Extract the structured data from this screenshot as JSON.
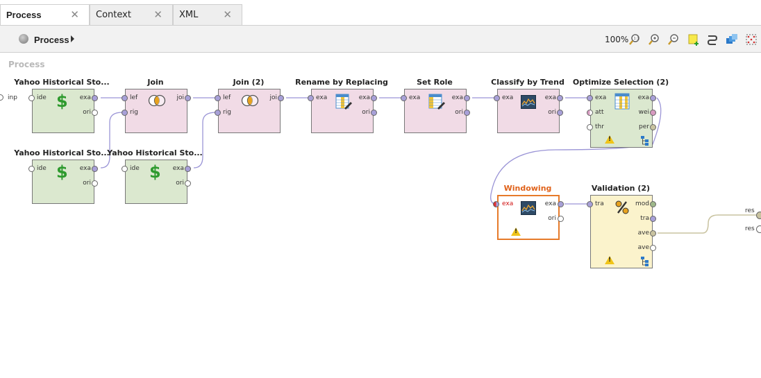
{
  "tabs": [
    {
      "label": "Process",
      "active": true
    },
    {
      "label": "Context",
      "active": false
    },
    {
      "label": "XML",
      "active": false
    }
  ],
  "toolbar": {
    "breadcrumb": "Process",
    "zoom": "100%",
    "icons": [
      "zoom-fit-icon",
      "zoom-in-icon",
      "zoom-out-icon",
      "add-note-icon",
      "auto-wire-icon",
      "arrange-icon",
      "show-grid-icon"
    ]
  },
  "canvas": {
    "label": "Process",
    "left_port": "inp",
    "right_ports": [
      "res",
      "res"
    ]
  },
  "operators": {
    "yahoo1": {
      "title": "Yahoo Historical Sto...",
      "in": [
        "ide"
      ],
      "out": [
        "exa",
        "ori"
      ]
    },
    "yahoo2": {
      "title": "Yahoo Historical Sto...",
      "in": [
        "ide"
      ],
      "out": [
        "exa",
        "ori"
      ]
    },
    "yahoo3": {
      "title": "Yahoo Historical Sto...",
      "in": [
        "ide"
      ],
      "out": [
        "exa",
        "ori"
      ]
    },
    "join1": {
      "title": "Join",
      "in": [
        "lef",
        "rig"
      ],
      "out": [
        "joi"
      ]
    },
    "join2": {
      "title": "Join (2)",
      "in": [
        "lef",
        "rig"
      ],
      "out": [
        "joi"
      ]
    },
    "rename": {
      "title": "Rename by Replacing",
      "in": [
        "exa"
      ],
      "out": [
        "exa",
        "ori"
      ]
    },
    "setrole": {
      "title": "Set Role",
      "in": [
        "exa"
      ],
      "out": [
        "exa",
        "ori"
      ]
    },
    "classify": {
      "title": "Classify by Trend",
      "in": [
        "exa"
      ],
      "out": [
        "exa",
        "ori"
      ]
    },
    "optimize": {
      "title": "Optimize Selection (2)",
      "in": [
        "exa",
        "att",
        "thr"
      ],
      "out": [
        "exa",
        "wei",
        "per"
      ]
    },
    "windowing": {
      "title": "Windowing",
      "in": [
        "exa"
      ],
      "out": [
        "exa",
        "ori"
      ]
    },
    "validation": {
      "title": "Validation (2)",
      "in": [
        "tra"
      ],
      "out": [
        "mod",
        "tra",
        "ave",
        "ave"
      ]
    }
  },
  "colors": {
    "data_port": "#a8a0d8",
    "model_port": "#9fb88a",
    "perf_port": "#c9c3a0",
    "weight_port": "#d79ac0",
    "edge": "#9a94d6",
    "selected_border": "#e67a2a"
  }
}
